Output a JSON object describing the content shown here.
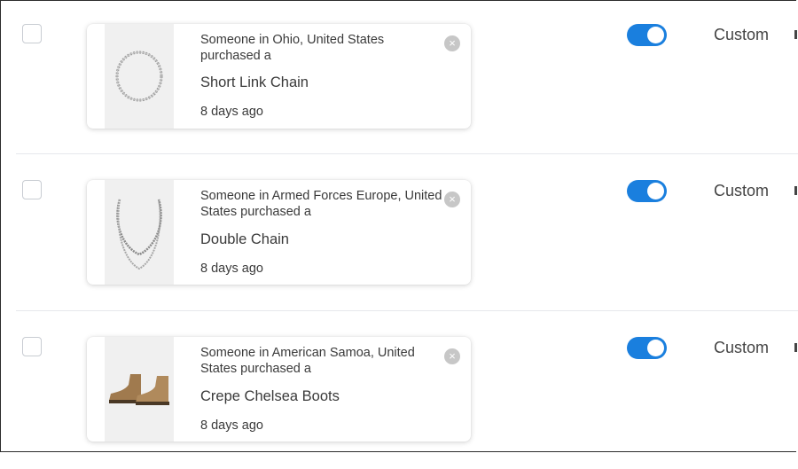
{
  "rows": [
    {
      "message": "Someone in Ohio, United States purchased a",
      "product": "Short Link Chain",
      "time": "8 days ago",
      "image_icon": "short-link-chain-image",
      "enabled": true,
      "mode": "Custom"
    },
    {
      "message": "Someone in Armed Forces Europe, United States purchased a",
      "product": "Double Chain",
      "time": "8 days ago",
      "image_icon": "double-chain-image",
      "enabled": true,
      "mode": "Custom"
    },
    {
      "message": "Someone in American Samoa, United States purchased a",
      "product": "Crepe Chelsea Boots",
      "time": "8 days ago",
      "image_icon": "chelsea-boots-image",
      "enabled": true,
      "mode": "Custom"
    }
  ],
  "colors": {
    "toggle_on": "#1a7fde",
    "close_button": "#c7c7c7",
    "divider": "#e6e8ec"
  },
  "icons": {
    "close": "×"
  }
}
